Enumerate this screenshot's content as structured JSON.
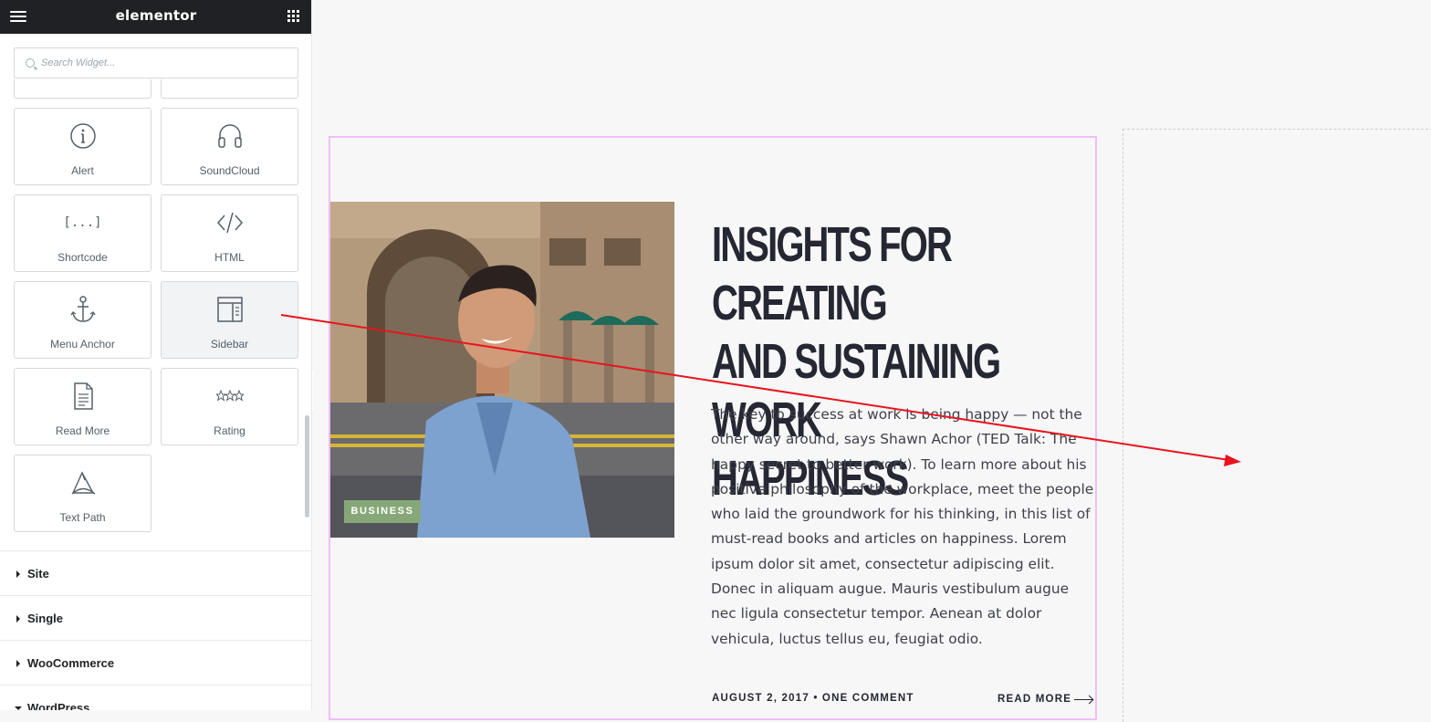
{
  "app": {
    "brand": "elementor"
  },
  "search": {
    "placeholder": "Search Widget..."
  },
  "widgets": [
    {
      "label": "Alert",
      "icon": "alert-icon"
    },
    {
      "label": "SoundCloud",
      "icon": "headphones-icon"
    },
    {
      "label": "Shortcode",
      "icon": "shortcode-icon"
    },
    {
      "label": "HTML",
      "icon": "code-icon"
    },
    {
      "label": "Menu Anchor",
      "icon": "anchor-icon"
    },
    {
      "label": "Sidebar",
      "icon": "sidebar-icon"
    },
    {
      "label": "Read More",
      "icon": "document-icon"
    },
    {
      "label": "Rating",
      "icon": "stars-icon"
    },
    {
      "label": "Text Path",
      "icon": "text-path-icon"
    }
  ],
  "shortcode_glyph": "[...]",
  "sections": [
    {
      "title": "Site",
      "expanded": false
    },
    {
      "title": "Single",
      "expanded": false
    },
    {
      "title": "WooCommerce",
      "expanded": false
    },
    {
      "title": "WordPress",
      "expanded": true
    }
  ],
  "post": {
    "badge": "BUSINESS",
    "title": "INSIGHTS FOR CREATING AND SUSTAINING WORK HAPPINESS",
    "title_lines": [
      "INSIGHTS FOR CREATING",
      "AND SUSTAINING WORK",
      "HAPPINESS"
    ],
    "excerpt": "The key to success at work is being happy — not the other way around, says Shawn Achor (TED Talk: The happy secret to better work). To learn more about his positive philosophy of the workplace, meet the people who laid the groundwork for his thinking, in this list of must-read books and articles on happiness. Lorem ipsum dolor sit amet, consectetur adipiscing elit. Donec in aliquam augue. Mauris vestibulum augue nec ligula consectetur tempor. Aenean at dolor vehicula, luctus tellus eu, feugiat odio.",
    "meta": "AUGUST 2, 2017 • ONE COMMENT",
    "read_more": "READ MORE"
  },
  "colors": {
    "topbar": "#1f2124",
    "highlight_border": "#f0bdf8",
    "badge_bg": "#86a878",
    "drag_arrow": "#e8141e"
  }
}
